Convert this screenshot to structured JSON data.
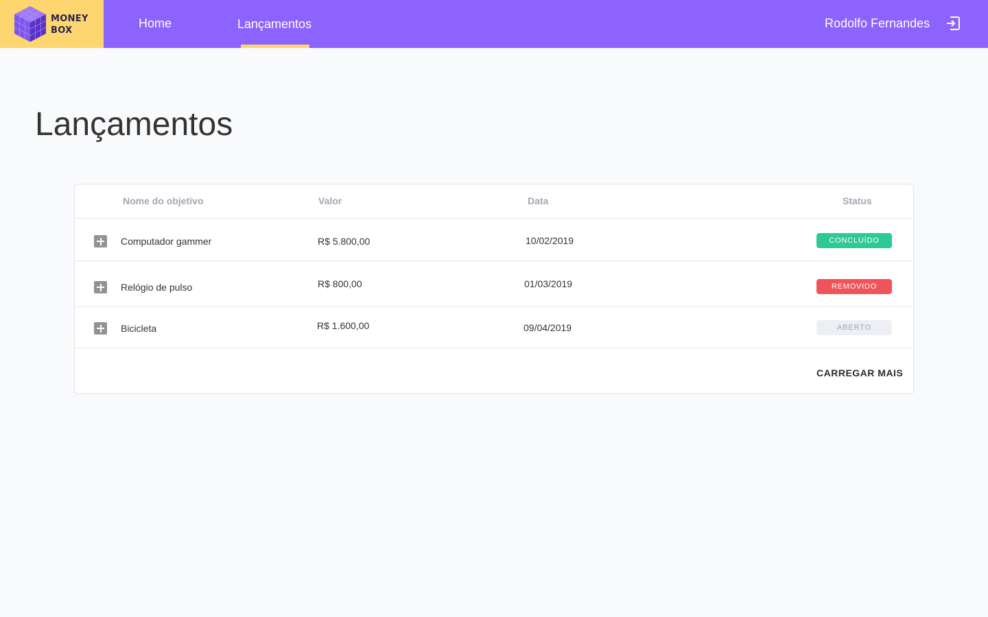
{
  "brand": {
    "line1": "MONEY",
    "line2": "BOX",
    "accent": "#fdd670",
    "primary": "#8c63fd"
  },
  "nav": {
    "items": [
      {
        "label": "Home",
        "active": false
      },
      {
        "label": "Lançamentos",
        "active": true
      }
    ]
  },
  "user": {
    "name": "Rodolfo Fernandes",
    "logout_icon": "logout-icon"
  },
  "page": {
    "title": "Lançamentos"
  },
  "table": {
    "headers": {
      "name": "Nome do objetivo",
      "value": "Valor",
      "date": "Data",
      "status": "Status"
    },
    "rows": [
      {
        "name": "Computador gammer",
        "value": "R$ 5.800,00",
        "date": "10/02/2019",
        "status": "CONCLUÍDO",
        "status_color": "#2dc997"
      },
      {
        "name": "Relógio de pulso",
        "value": "R$ 800,00",
        "date": "01/03/2019",
        "status": "REMOVIDO",
        "status_color": "#f0545a"
      },
      {
        "name": "Bicicleta",
        "value": "R$ 1.600,00",
        "date": "09/04/2019",
        "status": "ABERTO",
        "status_color": "#eeeff4"
      }
    ],
    "load_more": "CARREGAR MAIS"
  }
}
